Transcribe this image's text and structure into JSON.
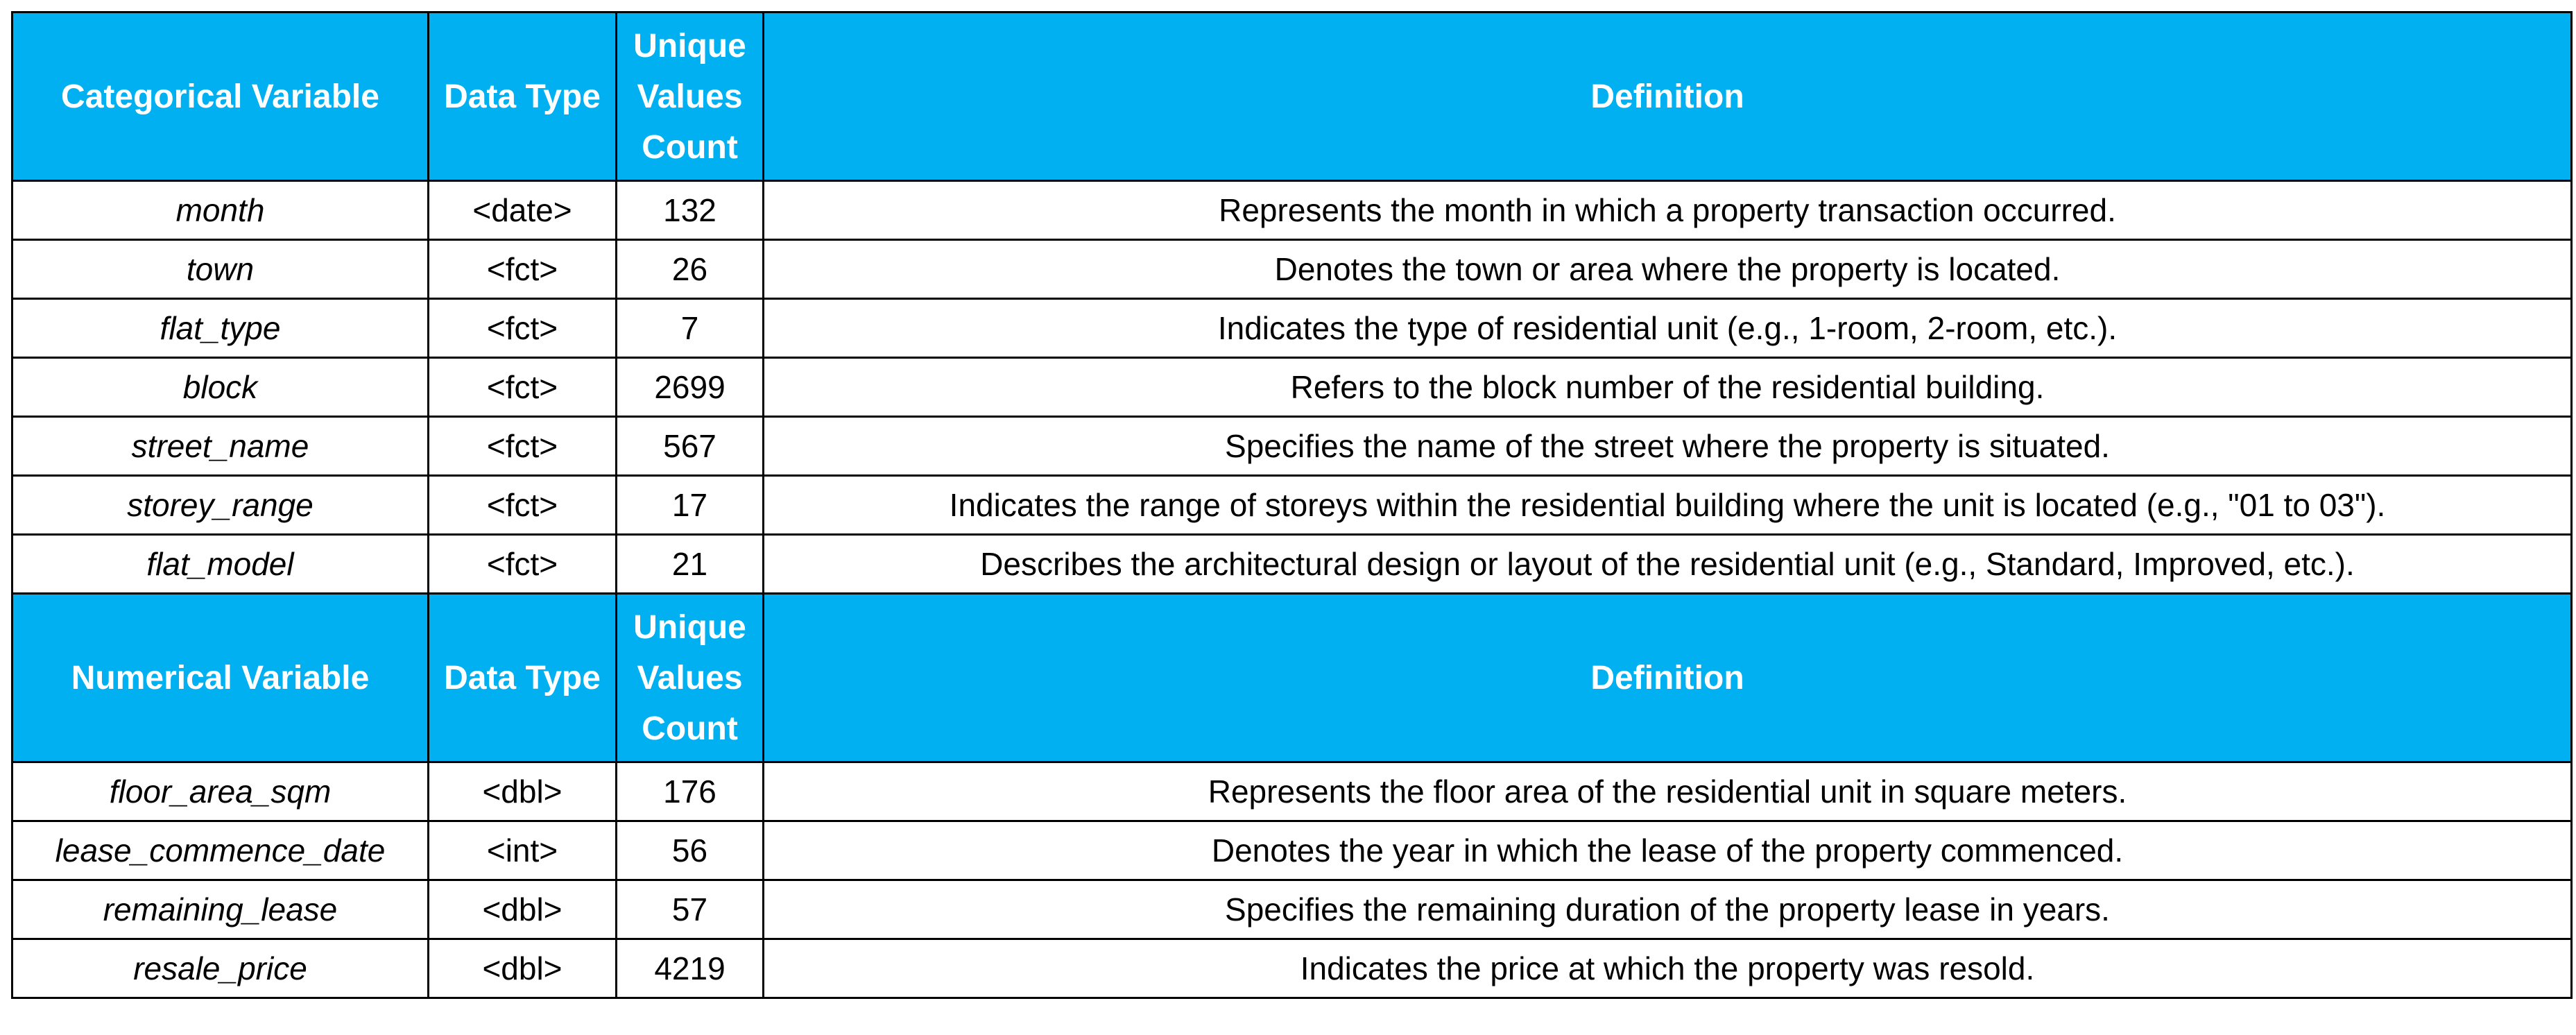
{
  "sections": [
    {
      "headers": [
        "Categorical Variable",
        "Data Type",
        "Unique Values Count",
        "Definition"
      ],
      "rows": [
        {
          "variable": "month",
          "type": "<date>",
          "count": "132",
          "definition": "Represents the month in which a property transaction occurred."
        },
        {
          "variable": "town",
          "type": "<fct>",
          "count": "26",
          "definition": "Denotes the town or area where the property is located."
        },
        {
          "variable": "flat_type",
          "type": "<fct>",
          "count": "7",
          "definition": "Indicates the type of residential unit (e.g., 1-room, 2-room, etc.)."
        },
        {
          "variable": "block",
          "type": "<fct>",
          "count": "2699",
          "definition": "Refers to the block number of the residential building."
        },
        {
          "variable": "street_name",
          "type": "<fct>",
          "count": "567",
          "definition": "Specifies the name of the street where the property is situated."
        },
        {
          "variable": "storey_range",
          "type": "<fct>",
          "count": "17",
          "definition": "Indicates the range of storeys within the residential building where the unit is located (e.g., \"01 to 03\")."
        },
        {
          "variable": "flat_model",
          "type": "<fct>",
          "count": "21",
          "definition": "Describes the architectural design or layout of the residential unit (e.g., Standard, Improved, etc.)."
        }
      ]
    },
    {
      "headers": [
        "Numerical Variable",
        "Data Type",
        "Unique Values Count",
        "Definition"
      ],
      "rows": [
        {
          "variable": "floor_area_sqm",
          "type": "<dbl>",
          "count": "176",
          "definition": "Represents the floor area of the residential unit in square meters."
        },
        {
          "variable": "lease_commence_date",
          "type": "<int>",
          "count": "56",
          "definition": "Denotes the year in which the lease of the property commenced."
        },
        {
          "variable": "remaining_lease",
          "type": "<dbl>",
          "count": "57",
          "definition": "Specifies the remaining duration of the property lease in years."
        },
        {
          "variable": "resale_price",
          "type": "<dbl>",
          "count": "4219",
          "definition": "Indicates the price at which the property was resold."
        }
      ]
    }
  ],
  "colors": {
    "header_background": "#00b0f0",
    "header_text": "#ffffff",
    "border": "#000000",
    "body_text": "#000000"
  }
}
